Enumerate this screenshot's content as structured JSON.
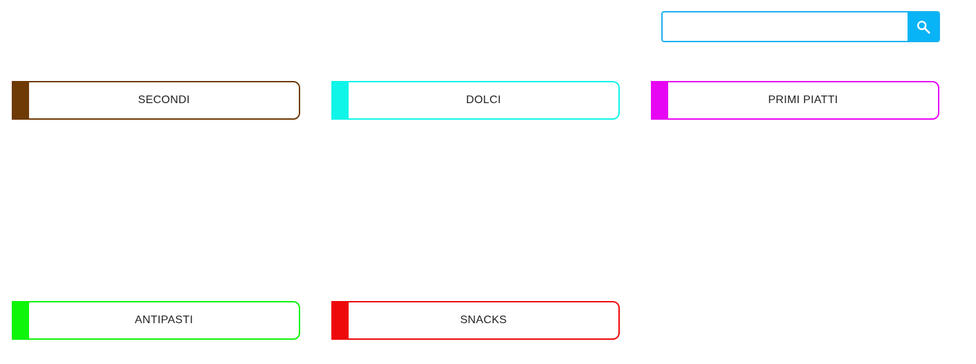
{
  "search": {
    "placeholder": "",
    "value": "",
    "button_icon": "search-icon",
    "border_color": "#1ab1f0",
    "button_color": "#08b4f6"
  },
  "categories": [
    {
      "label": "SECONDI",
      "color": "#6e3a05"
    },
    {
      "label": "DOLCI",
      "color": "#0ff5e8"
    },
    {
      "label": "PRIMI PIATTI",
      "color": "#e706f4"
    },
    {
      "label": "ANTIPASTI",
      "color": "#0ef50a"
    },
    {
      "label": "SNACKS",
      "color": "#ee0a0a"
    }
  ]
}
